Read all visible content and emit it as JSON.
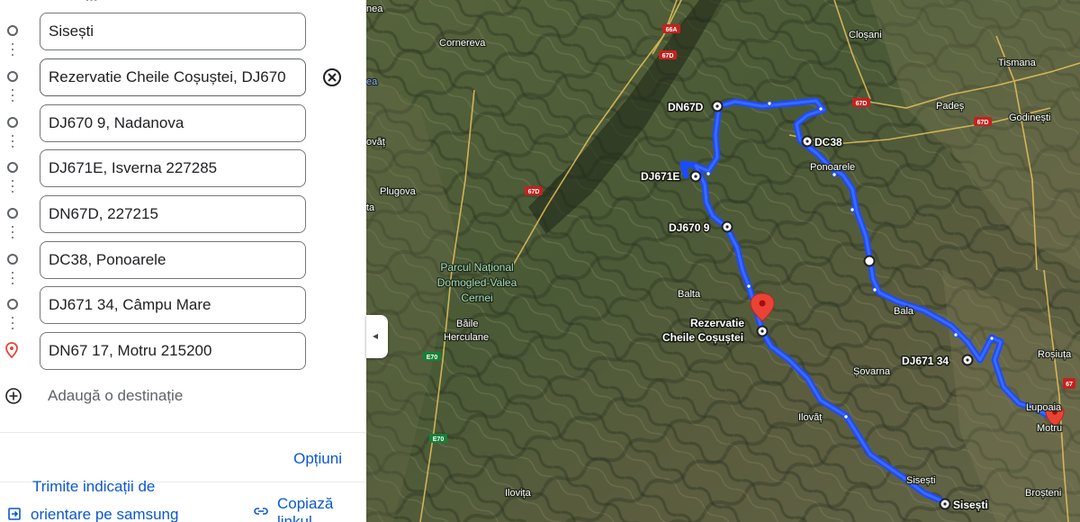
{
  "panel": {
    "stops": [
      {
        "value": "Sisești",
        "placeholder": ""
      },
      {
        "value": "Rezervatie Cheile Coșuștei, DJ670",
        "placeholder": ""
      },
      {
        "value": "DJ670 9, Nadanova",
        "placeholder": ""
      },
      {
        "value": "DJ671E, Isverna 227285",
        "placeholder": ""
      },
      {
        "value": "DN67D, 227215",
        "placeholder": ""
      },
      {
        "value": "DC38, Ponoarele",
        "placeholder": ""
      },
      {
        "value": "DJ671 34, Câmpu Mare",
        "placeholder": ""
      },
      {
        "value": "DN67 17, Motru 215200",
        "placeholder": ""
      }
    ],
    "add_destination": "Adaugă o destinație",
    "options": "Opțiuni",
    "send_label_cut": "Trimite indicații de",
    "send_label": "orientare pe samsung",
    "copy_label": "Copiază",
    "copy_label_cut": "linkul",
    "icons": {
      "stop": "circle-icon",
      "clear": "close-circle-icon",
      "destination": "red-pin-icon",
      "add": "plus-circle-icon",
      "send": "send-to-device-icon",
      "copy": "link-icon",
      "collapse": "chevron-left-icon"
    }
  },
  "map": {
    "places": {
      "cornereva": "Cornereva",
      "closani": "Cloșani",
      "tismana": "Tismana",
      "pades": "Padeș",
      "godinesti": "Godinești",
      "plugova": "Plugova",
      "parcul": "Parcul Național",
      "domogled": "Domogled-Valea",
      "cernei": "Cernei",
      "baile": "Băile",
      "herculane": "Herculane",
      "balta": "Balta",
      "ponoarele": "Ponoarele",
      "bala": "Bala",
      "sovarna": "Șovarna",
      "ilovat": "Ilovăț",
      "sisesti_small": "Sisești",
      "ilovita": "Ilovița",
      "rosiuta": "Roșiuța",
      "lupoaia": "Lupoaia",
      "motru": "Motru",
      "brosteni": "Broșteni",
      "nea": "nea",
      "ea": "ea",
      "ovat": "ovăț",
      "ta": "ta"
    },
    "route_labels": {
      "dn67d": "DN67D",
      "dc38": "DC38",
      "dj671e": "DJ671E",
      "dj670": "DJ670 9",
      "rezervatie1": "Rezervatie",
      "rezervatie2": "Cheile Coșuștei",
      "dj671": "DJ671 34",
      "sisesti": "Sisești"
    },
    "road_shields": {
      "s66a": "66A",
      "s67d_1": "67D",
      "s67d_2": "67D",
      "s67d_3": "67D",
      "s67d_4": "67D",
      "s67": "67",
      "e70_1": "E70",
      "e70_2": "E70"
    },
    "colors": {
      "route": "#1a53ff",
      "pin": "#ea4335"
    }
  }
}
